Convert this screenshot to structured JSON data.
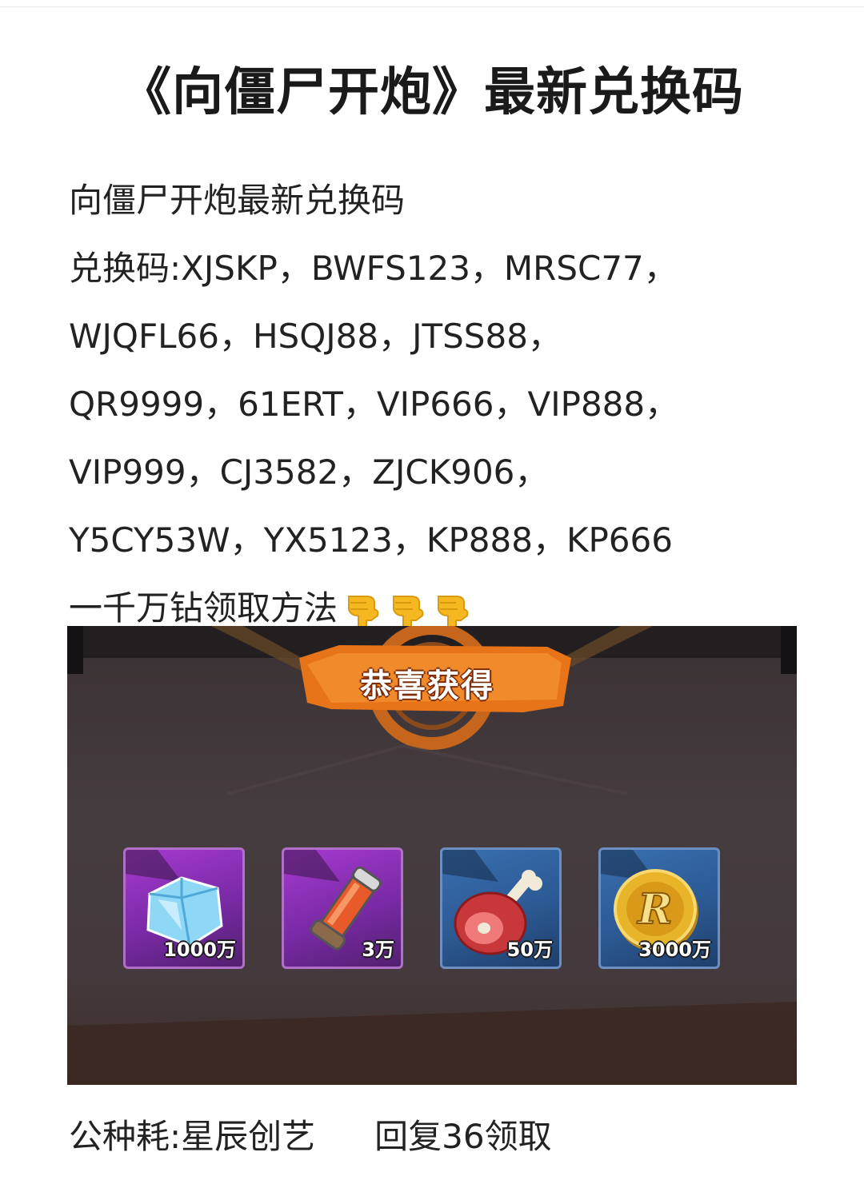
{
  "article": {
    "title": "《向僵尸开炮》最新兑换码",
    "lines": [
      "向僵尸开炮最新兑换码",
      "兑换码:XJSKP，BWFS123，MRSC77，",
      "WJQFL66，HSQJ88，JTSS88，",
      "QR9999，61ERT，VIP666，VIP888，",
      "VIP999，CJ3582，ZJCK906，",
      "Y5CY53W，YX5123，KP888，KP666",
      "一千万钻领取方法"
    ],
    "hand_icons": [
      "pointing-down-hand-icon",
      "pointing-down-hand-icon",
      "pointing-down-hand-icon"
    ]
  },
  "game_screenshot": {
    "banner": "恭喜获得",
    "items": [
      {
        "icon": "diamond-icon",
        "quantity": "1000万",
        "frame": "purple"
      },
      {
        "icon": "potion-tube-icon",
        "quantity": "3万",
        "frame": "purple"
      },
      {
        "icon": "meat-drumstick-icon",
        "quantity": "50万",
        "frame": "blue"
      },
      {
        "icon": "gold-coin-icon",
        "quantity": "3000万",
        "frame": "blue"
      }
    ]
  },
  "footer": {
    "left": "公种耗:星辰创艺",
    "right": "回复36领取"
  },
  "colors": {
    "hand": "#f5b820",
    "banner": "#e8741a",
    "purple_frame": "#8a2fb8",
    "blue_frame": "#2c5a94",
    "coin": "#e8b52a"
  }
}
